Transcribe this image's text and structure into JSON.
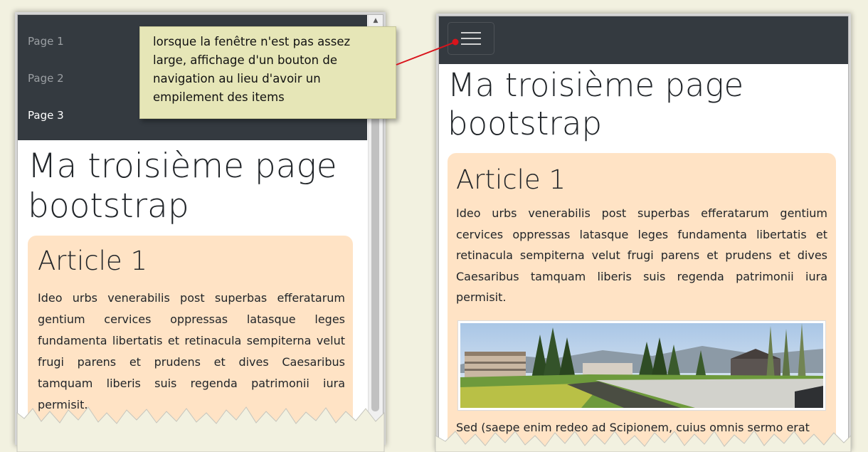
{
  "left_window": {
    "nav_items": [
      {
        "label": "Page 1",
        "active": false
      },
      {
        "label": "Page 2",
        "active": false
      },
      {
        "label": "Page 3",
        "active": true
      }
    ],
    "title": "Ma troisième page bootstrap",
    "article": {
      "heading": "Article 1",
      "text": "Ideo urbs venerabilis post superbas efferatarum gentium cervices oppressas latasque leges fundamenta libertatis et retinacula sempiterna velut frugi parens et prudens et dives Caesaribus tamquam liberis suis regenda patrimonii iura permisit."
    }
  },
  "right_window": {
    "toggler_icon": "hamburger-menu-icon",
    "title": "Ma troisième page bootstrap",
    "article": {
      "heading": "Article 1",
      "text": "Ideo urbs venerabilis post superbas efferatarum gentium cervices oppressas latasque leges fundamenta libertatis et retinacula sempiterna velut frugi parens et prudens et dives Caesaribus tamquam liberis suis regenda patrimonii iura permisit.",
      "continuation": "Sed (saepe enim redeo ad Scipionem, cuius omnis sermo erat"
    }
  },
  "annotation": {
    "text": "lorsque la fenêtre n'est pas assez large, affichage d'un bouton de navigation au lieu d'avoir un empilement des items"
  },
  "colors": {
    "navbar": "#343a40",
    "article_bg": "#ffe3c5",
    "annotation_bg": "#e6e6b7",
    "arrow": "#d9141c",
    "page_bg": "#f2f1e0"
  }
}
